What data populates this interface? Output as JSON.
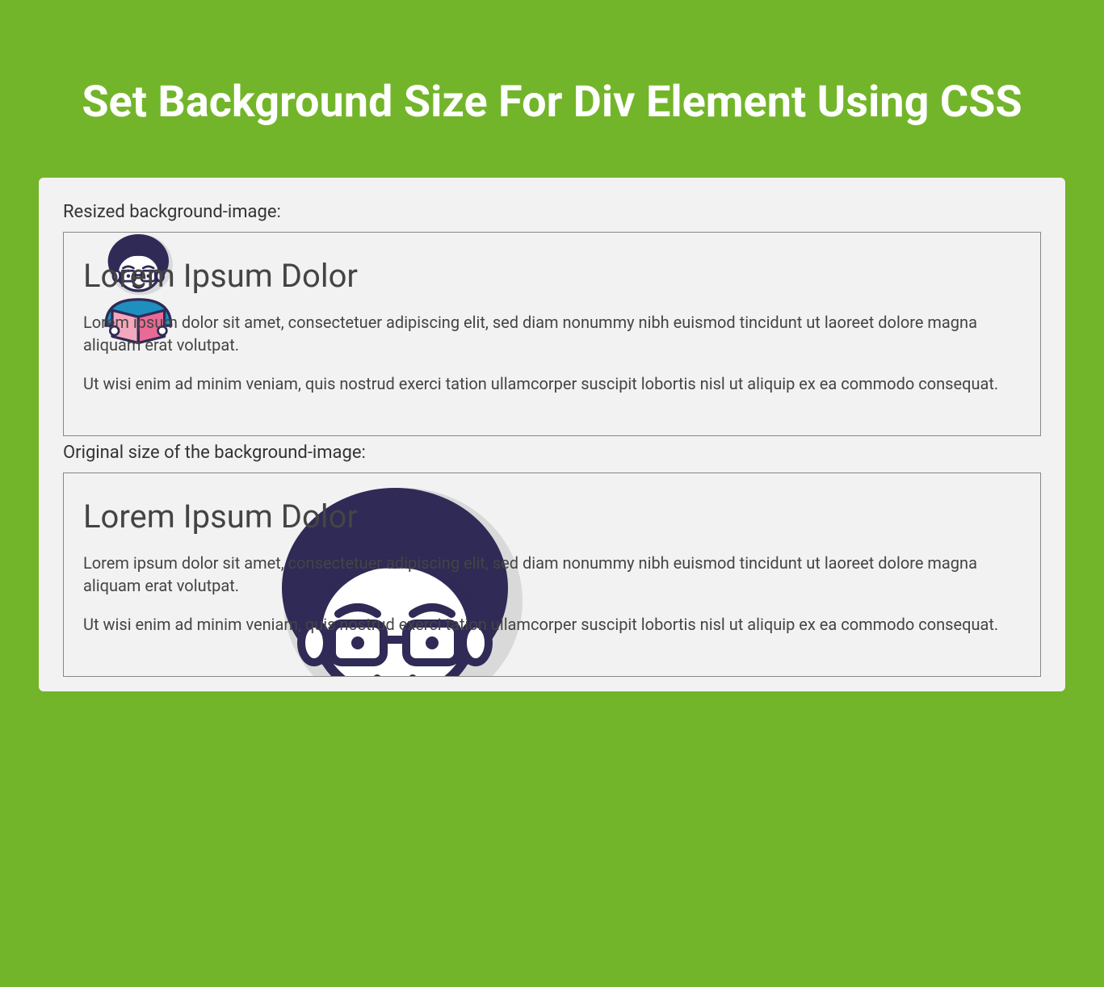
{
  "page_title": "Set Background Size For Div Element Using CSS",
  "section1": {
    "label": "Resized background-image:",
    "heading": "Lorem Ipsum Dolor",
    "para1": "Lorem ipsum dolor sit amet, consectetuer adipiscing elit, sed diam nonummy nibh euismod tincidunt ut laoreet dolore magna aliquam erat volutpat.",
    "para2": "Ut wisi enim ad minim veniam, quis nostrud exerci tation ullamcorper suscipit lobortis nisl ut aliquip ex ea commodo consequat."
  },
  "section2": {
    "label": "Original size of the background-image:",
    "heading": "Lorem Ipsum Dolor",
    "para1": "Lorem ipsum dolor sit amet, consectetuer adipiscing elit, sed diam nonummy nibh euismod tincidunt ut laoreet dolore magna aliquam erat volutpat.",
    "para2": "Ut wisi enim ad minim veniam, quis nostrud exerci tation ullamcorper suscipit lobortis nisl ut aliquip ex ea commodo consequat."
  },
  "colors": {
    "page_bg": "#73b52a",
    "card_bg": "#f2f2f2",
    "hair": "#2f2a56",
    "skin": "#ffffff",
    "book": "#e96b95",
    "shirt": "#1e8fbf",
    "outline": "#2f2a56"
  }
}
